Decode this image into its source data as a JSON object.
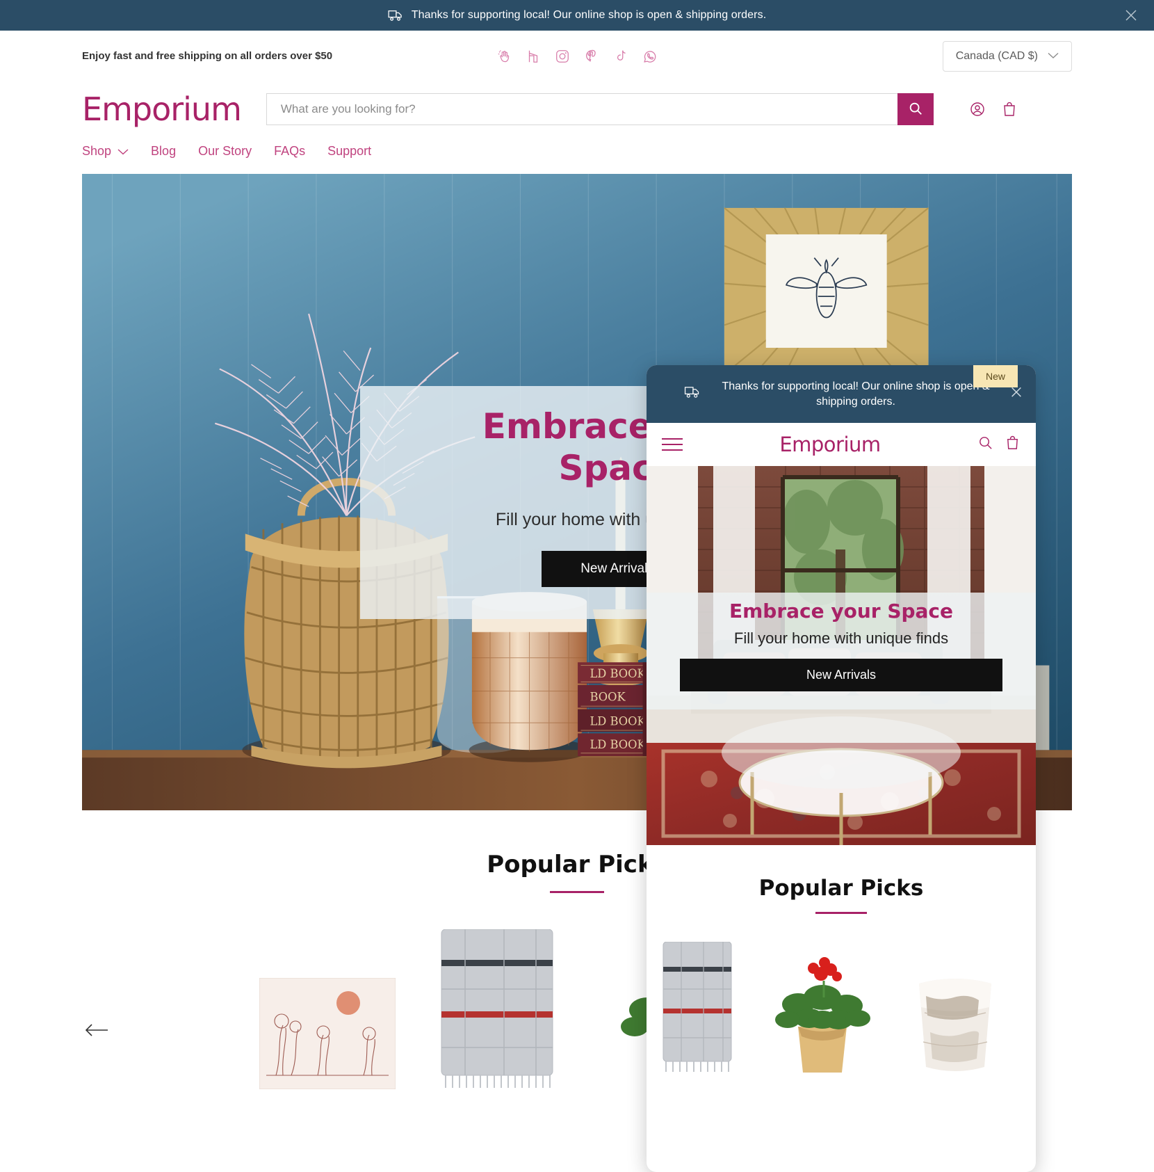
{
  "announcement": {
    "text": "Thanks for supporting local! Our online shop is open & shipping orders.",
    "icon": "truck-icon",
    "close_icon": "close-icon",
    "background": "#2b4d66"
  },
  "utility": {
    "message": "Enjoy fast and free shipping on all orders over $50",
    "social": [
      {
        "name": "clap-icon",
        "label": "Clap"
      },
      {
        "name": "houzz-icon",
        "label": "Houzz"
      },
      {
        "name": "instagram-icon",
        "label": "Instagram"
      },
      {
        "name": "pinterest-icon",
        "label": "Pinterest"
      },
      {
        "name": "tiktok-icon",
        "label": "TikTok"
      },
      {
        "name": "whatsapp-icon",
        "label": "WhatsApp"
      }
    ],
    "currency": {
      "value": "Canada (CAD $)",
      "chevron": "chevron-down-icon"
    }
  },
  "header": {
    "logo": "Emporium",
    "search_placeholder": "What are you looking for?",
    "search_value": "",
    "search_icon": "search-icon",
    "account_icon": "account-icon",
    "cart_icon": "bag-icon"
  },
  "nav": {
    "items": [
      {
        "label": "Shop",
        "has_chevron": true
      },
      {
        "label": "Blog",
        "has_chevron": false
      },
      {
        "label": "Our Story",
        "has_chevron": false
      },
      {
        "label": "FAQs",
        "has_chevron": false
      },
      {
        "label": "Support",
        "has_chevron": false
      }
    ]
  },
  "hero": {
    "title_line1": "Embrace your",
    "title_line2": "Space",
    "subtitle": "Fill your home with unique finds",
    "button": "New Arrivals"
  },
  "picks": {
    "heading": "Popular Picks",
    "prev_arrow": "arrow-left-icon"
  },
  "mobile": {
    "announcement": "Thanks for supporting local! Our online shop is open & shipping orders.",
    "logo": "Emporium",
    "menu_icon": "hamburger-icon",
    "search_icon": "search-icon",
    "cart_icon": "bag-icon",
    "close_icon": "close-icon",
    "hero": {
      "title": "Embrace your Space",
      "subtitle": "Fill your home with unique finds",
      "button": "New Arrivals"
    },
    "picks": {
      "heading": "Popular Picks",
      "badge": "New"
    }
  },
  "colors": {
    "brand": "#a82267",
    "nav_link": "#c0437f",
    "announce_bg": "#2b4d66",
    "badge_bg": "#f7e6b4",
    "button_bg": "#111111"
  }
}
